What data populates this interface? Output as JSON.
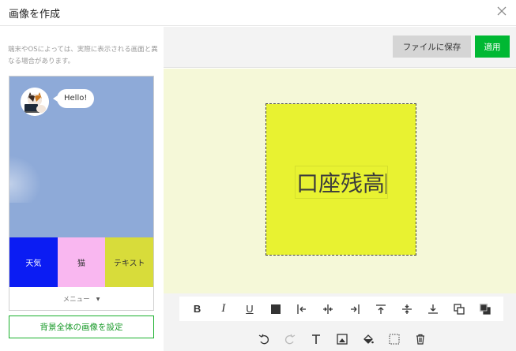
{
  "dialog": {
    "title": "画像を作成"
  },
  "preview": {
    "note": "端末やOSによっては、実際に表示される画面と異なる場合があります。",
    "bubble_text": "Hello!",
    "richmenu": [
      {
        "label": "天気",
        "color": "#0b1cf3"
      },
      {
        "label": "猫",
        "color": "#f9b7f0"
      },
      {
        "label": "テキスト",
        "color": "#d8dc3a"
      }
    ],
    "menu_label": "メニュー"
  },
  "buttons": {
    "set_background": "背景全体の画像を設定",
    "save_file": "ファイルに保存",
    "apply": "適用"
  },
  "canvas": {
    "background": "#f5f8d8",
    "tile_color": "#e8f231",
    "tile_text": "口座残高"
  },
  "toolbar": {
    "row1": [
      "bold-icon",
      "italic-icon",
      "underline-icon",
      "text-color-icon",
      "align-left-icon",
      "align-center-h-icon",
      "align-right-icon",
      "align-top-icon",
      "align-middle-v-icon",
      "align-bottom-icon",
      "bring-forward-icon",
      "send-backward-icon"
    ],
    "row2": [
      "undo-icon",
      "redo-icon",
      "add-text-icon",
      "add-image-icon",
      "fill-color-icon",
      "transparency-icon",
      "delete-icon"
    ]
  }
}
